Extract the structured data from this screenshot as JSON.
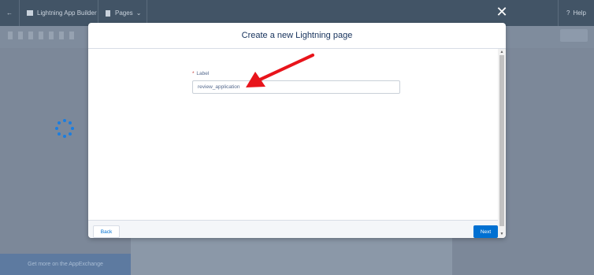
{
  "header": {
    "back_icon": "back-arrow-icon",
    "app_name": "Lightning App Builder",
    "pages_label": "Pages",
    "help_label": "Help"
  },
  "background": {
    "appexchange_text": "Get more on the AppExchange"
  },
  "modal": {
    "title": "Create a new Lightning page",
    "close_icon": "close-icon",
    "field": {
      "label": "Label",
      "required_marker": "*",
      "value": "review_application"
    },
    "footer": {
      "back_label": "Back",
      "next_label": "Next"
    }
  },
  "colors": {
    "header_bg": "#425466",
    "overlay_bg": "#8a96a7",
    "accent": "#0070d2",
    "spinner": "#1b7ee0",
    "annotation_arrow": "#e8141b"
  }
}
